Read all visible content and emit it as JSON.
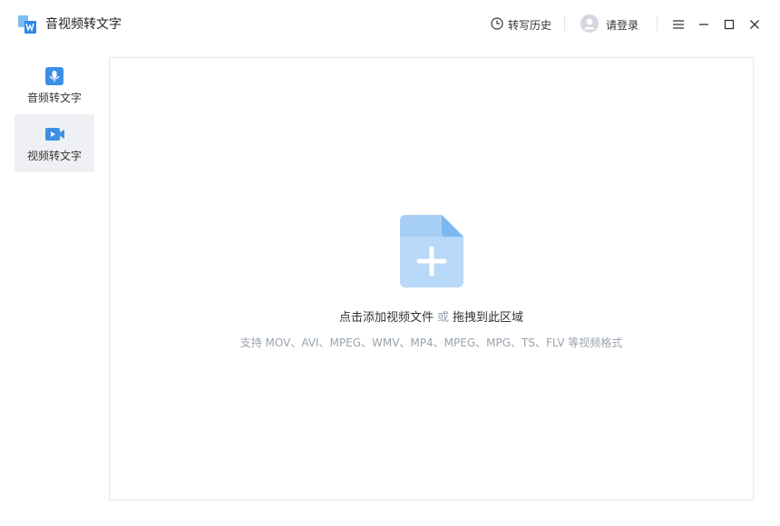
{
  "app": {
    "title": "音视频转文字",
    "logo_icon": "app-logo-icon"
  },
  "header": {
    "history_label": "转写历史",
    "login_label": "请登录",
    "icons": [
      "clock-icon",
      "avatar-icon",
      "menu-icon",
      "minimize-icon",
      "maximize-icon",
      "close-icon"
    ]
  },
  "sidebar": {
    "items": [
      {
        "label": "音频转文字",
        "icon": "microphone-icon",
        "active": false
      },
      {
        "label": "视频转文字",
        "icon": "video-camera-icon",
        "active": true
      }
    ]
  },
  "dropzone": {
    "main_text_part1": "点击添加视频文件",
    "or_text": "或",
    "main_text_part2": "拖拽到此区域",
    "formats_text": "支持 MOV、AVI、MPEG、WMV、MP4、MPEG、MPG、TS、FLV 等视频格式",
    "icon": "add-file-icon"
  },
  "colors": {
    "accent": "#3d8fe6",
    "file_icon_body": "#b7d8f7",
    "file_icon_fold": "#7cb8f0",
    "active_sidebar_bg": "#eef0f3"
  }
}
